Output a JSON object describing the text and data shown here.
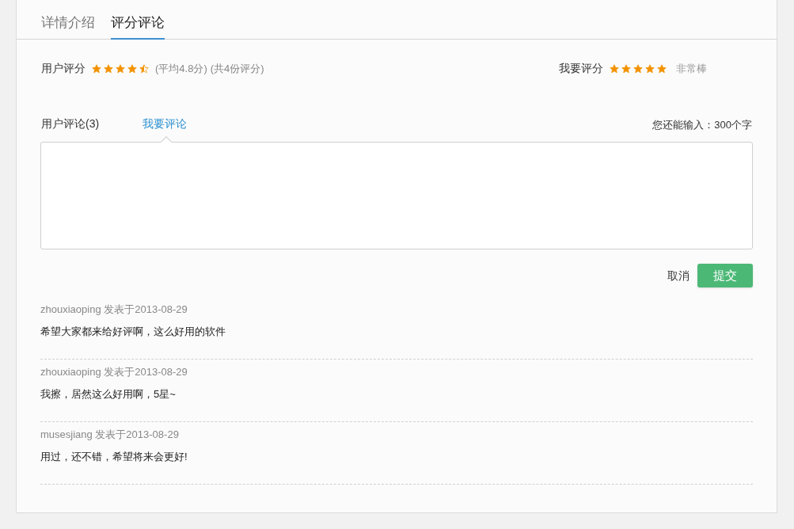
{
  "tabs": [
    {
      "label": "详情介绍",
      "selected": false
    },
    {
      "label": "评分评论",
      "selected": true
    }
  ],
  "user_rating": {
    "label": "用户评分",
    "stars": 4.5,
    "average": "(平均4.8分)",
    "count": "(共4份评分)"
  },
  "my_rating": {
    "label": "我要评分",
    "stars": 5,
    "verdict": "非常棒"
  },
  "comment_tabs": [
    {
      "label": "用户评论(3)",
      "selected": false
    },
    {
      "label": "我要评论",
      "selected": true
    }
  ],
  "remaining": "您还能输入：300个字",
  "buttons": {
    "cancel": "取消",
    "submit": "提交"
  },
  "comments": [
    {
      "meta": "zhouxiaoping 发表于2013-08-29",
      "text": "希望大家都来给好评啊，这么好用的软件"
    },
    {
      "meta": "zhouxiaoping 发表于2013-08-29",
      "text": "我擦，居然这么好用啊，5星~"
    },
    {
      "meta": "musesjiang 发表于2013-08-29",
      "text": "用过，还不错，希望将来会更好!"
    }
  ]
}
